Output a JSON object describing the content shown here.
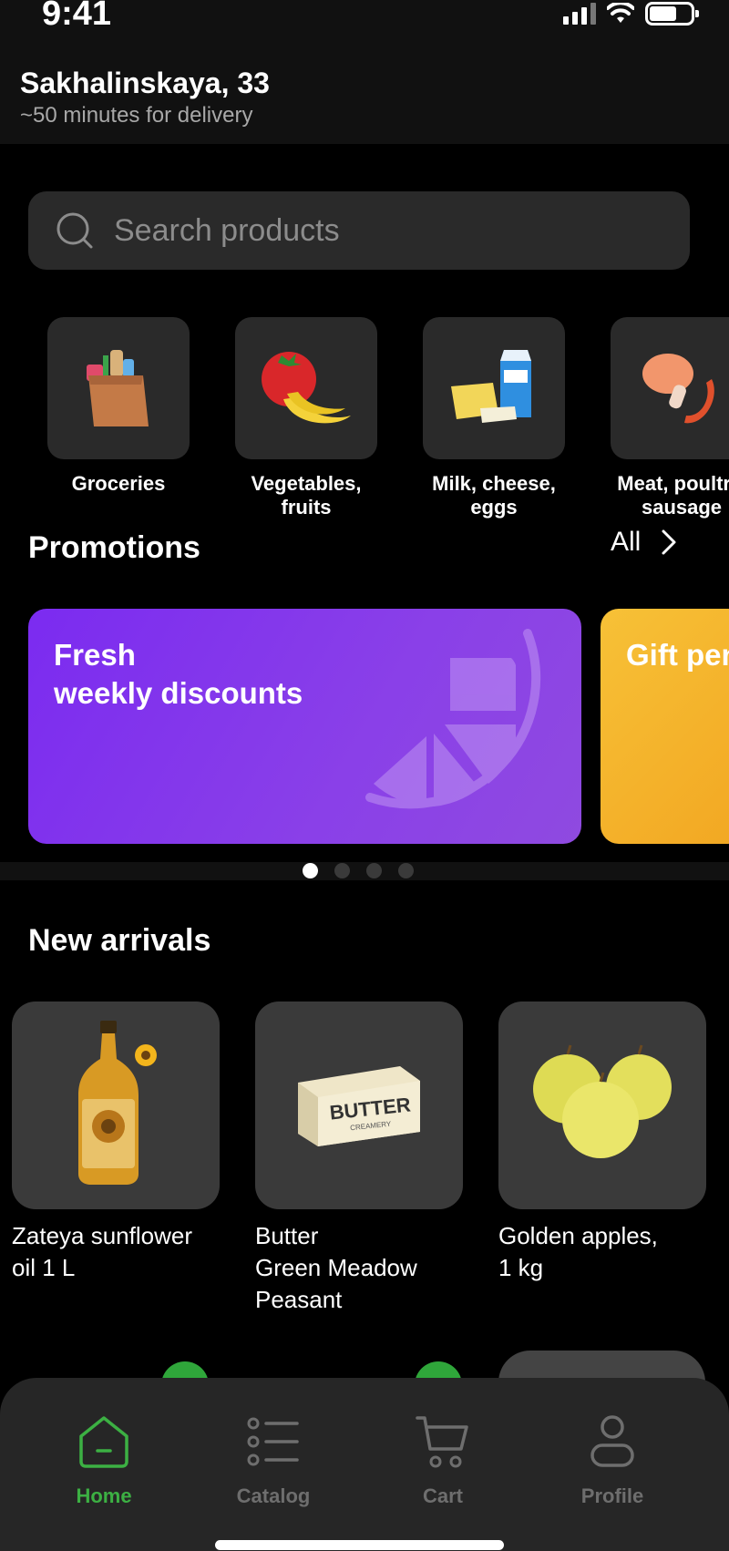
{
  "status_bar": {
    "time": "9:41"
  },
  "header": {
    "address": "Sakhalinskaya, 33",
    "delivery_estimate": "~50 minutes for delivery"
  },
  "search": {
    "placeholder": "Search products",
    "icon": "search-icon"
  },
  "categories": [
    {
      "label": "Groceries",
      "icon": "grocery-bag-icon"
    },
    {
      "label_lines": [
        "Vegetables,",
        "fruits"
      ],
      "icon": "tomato-banana-icon"
    },
    {
      "label_lines": [
        "Milk, cheese,",
        "eggs"
      ],
      "icon": "milk-cheese-icon"
    },
    {
      "label_lines": [
        "Meat, poultry,",
        "sausage"
      ],
      "icon": "meat-sausage-icon"
    }
  ],
  "promotions": {
    "title": "Promotions",
    "all_label": "All",
    "cards": [
      {
        "title_lines": [
          "Fresh",
          "weekly discounts"
        ],
        "color": "#7b2bf0"
      },
      {
        "title_lines": [
          "Gift pen"
        ],
        "color": "#f7c137"
      }
    ],
    "page_count": 4,
    "active_page": 1
  },
  "new_arrivals": {
    "title": "New arrivals",
    "products": [
      {
        "name_lines": [
          "Zateya sunflower",
          "oil 1 L"
        ],
        "image": "sunflower-oil-bottle"
      },
      {
        "name_lines": [
          "Butter",
          "Green Meadow",
          "Peasant"
        ],
        "image": "butter-package",
        "package_text": "BUTTER",
        "package_subtext": "CREAMERY"
      },
      {
        "name_lines": [
          "Golden apples,",
          "1 kg"
        ],
        "image": "golden-apples"
      }
    ]
  },
  "tabbar": {
    "items": [
      {
        "label": "Home",
        "icon": "home-icon",
        "active": true
      },
      {
        "label": "Catalog",
        "icon": "catalog-list-icon",
        "active": false
      },
      {
        "label": "Cart",
        "icon": "cart-icon",
        "active": false
      },
      {
        "label": "Profile",
        "icon": "profile-icon",
        "active": false
      }
    ]
  },
  "colors": {
    "accent": "#3cb043",
    "background": "#000000",
    "surface": "#2a2a2a"
  }
}
